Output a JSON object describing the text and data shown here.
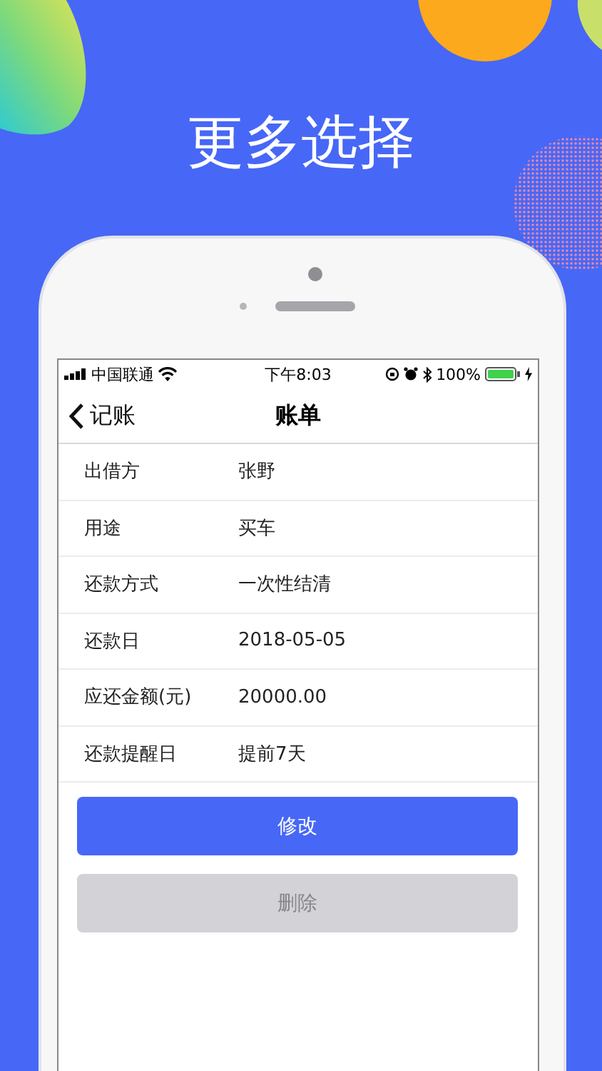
{
  "headline": "更多选择",
  "status_bar": {
    "carrier": "中国联通",
    "time": "下午8:03",
    "battery": "100%"
  },
  "nav": {
    "back": "记账",
    "title": "账单"
  },
  "rows": [
    {
      "label": "出借方",
      "value": "张野"
    },
    {
      "label": "用途",
      "value": "买车"
    },
    {
      "label": "还款方式",
      "value": "一次性结清"
    },
    {
      "label": "还款日",
      "value": "2018-05-05"
    },
    {
      "label": "应还金额(元)",
      "value": "20000.00"
    },
    {
      "label": "还款提醒日",
      "value": "提前7天"
    }
  ],
  "buttons": [
    {
      "label": "修改",
      "disabled": false
    },
    {
      "label": "删除",
      "disabled": true
    }
  ]
}
